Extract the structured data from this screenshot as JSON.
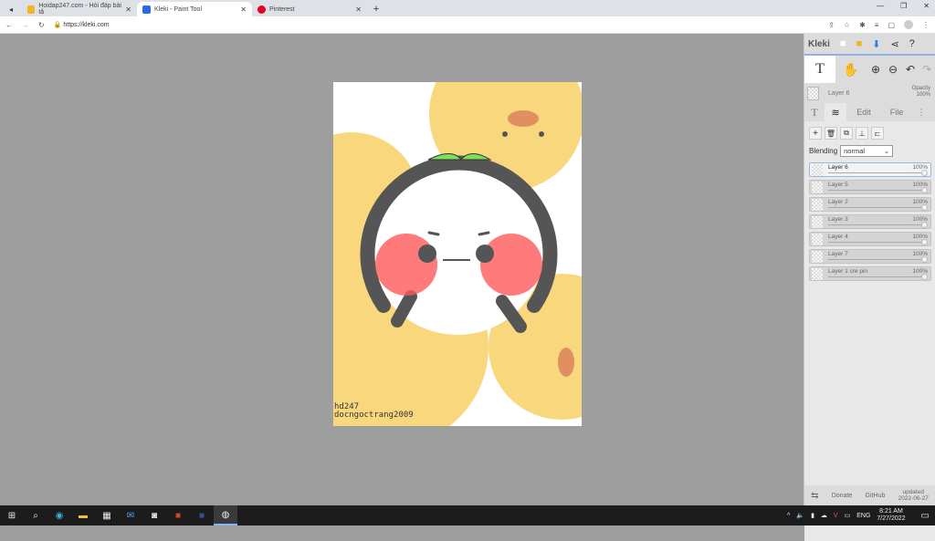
{
  "browser": {
    "tabs": [
      {
        "title": "Hoidap247.com - Hỏi đáp bài tậ",
        "active": false,
        "color": "#f0b429"
      },
      {
        "title": "Kleki - Paint Tool",
        "active": true,
        "color": "#2a6ae0"
      },
      {
        "title": "Pinterest",
        "active": false,
        "color": "#e60023"
      }
    ],
    "url": "https://kleki.com"
  },
  "canvas": {
    "watermark_line1": "hd247",
    "watermark_line2": "docngoctrang2009"
  },
  "panel": {
    "logo": "Kleki",
    "current_layer": "Layer 6",
    "opacity_label": "Opacity",
    "opacity_value": "100%",
    "tabs": {
      "edit": "Edit",
      "file": "File"
    },
    "blending_label": "Blending",
    "blending_value": "normal",
    "layers": [
      {
        "name": "Layer 6",
        "opacity": "100%",
        "selected": true
      },
      {
        "name": "Layer 5",
        "opacity": "100%"
      },
      {
        "name": "Layer 2",
        "opacity": "100%"
      },
      {
        "name": "Layer 3",
        "opacity": "100%"
      },
      {
        "name": "Layer 4",
        "opacity": "100%"
      },
      {
        "name": "Layer 7",
        "opacity": "100%"
      },
      {
        "name": "Layer 1 cre pin",
        "opacity": "100%"
      }
    ],
    "footer": {
      "donate": "Donate",
      "github": "GitHub",
      "updated_label": "updated",
      "updated_date": "2022-06-27"
    }
  },
  "taskbar": {
    "lang": "ENG",
    "time": "8:21 AM",
    "date": "7/27/2022"
  }
}
